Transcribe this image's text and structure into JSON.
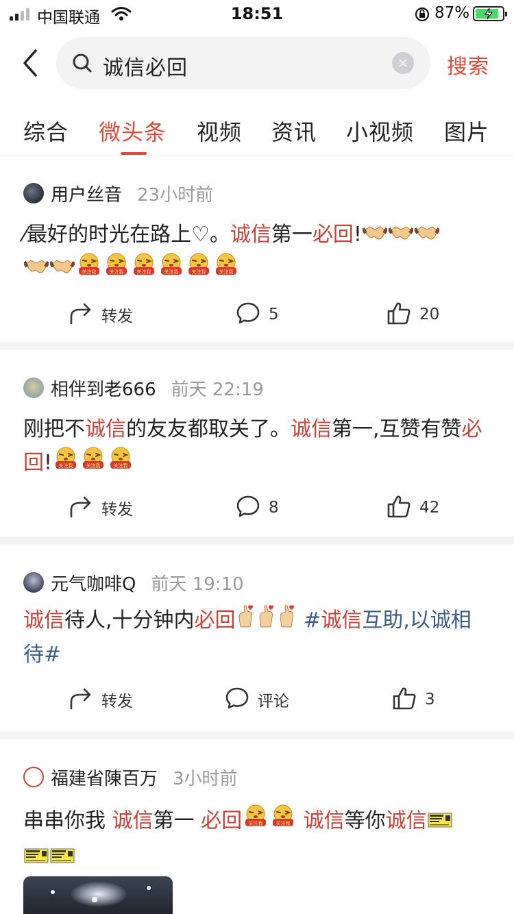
{
  "status_bar": {
    "carrier": "中国联通",
    "time": "18:51",
    "battery_pct": "87%",
    "battery_level": 0.87
  },
  "search": {
    "query": "诚信必回",
    "submit_label": "搜索"
  },
  "tabs": [
    {
      "label": "综合",
      "active": false
    },
    {
      "label": "微头条",
      "active": true
    },
    {
      "label": "视频",
      "active": false
    },
    {
      "label": "资讯",
      "active": false
    },
    {
      "label": "小视频",
      "active": false
    },
    {
      "label": "图片",
      "active": false
    }
  ],
  "posts": [
    {
      "author": "用户丝音",
      "time": "23小时前",
      "content": [
        {
          "t": "⁄最好的时光在路上♡。"
        },
        {
          "t": "诚信",
          "hl": true
        },
        {
          "t": "第一"
        },
        {
          "t": "必回",
          "hl": true
        },
        {
          "t": "!"
        }
      ],
      "emoji_line1": [
        "handshake-emoji",
        "handshake-emoji",
        "handshake-emoji"
      ],
      "emoji_line2": [
        "handshake-emoji",
        "handshake-emoji",
        "follow-me-emoji",
        "follow-me-emoji",
        "follow-me-emoji",
        "follow-me-emoji",
        "follow-me-emoji",
        "follow-me-emoji"
      ],
      "actions": {
        "repost": "转发",
        "comment": "5",
        "like": "20"
      }
    },
    {
      "author": "相伴到老666",
      "time": "前天 22:19",
      "content": [
        {
          "t": "刚把不"
        },
        {
          "t": "诚信",
          "hl": true
        },
        {
          "t": "的友友都取关了。"
        },
        {
          "t": "诚信",
          "hl": true
        },
        {
          "t": "第一,互赞有赞"
        },
        {
          "t": "必回",
          "hl": true
        },
        {
          "t": "!"
        }
      ],
      "emoji_tail": [
        "follow-me-emoji",
        "follow-me-emoji",
        "follow-me-emoji"
      ],
      "actions": {
        "repost": "转发",
        "comment": "8",
        "like": "42"
      }
    },
    {
      "author": "元气咖啡Q",
      "time": "前天 19:10",
      "content": [
        {
          "t": "诚信",
          "hl": true
        },
        {
          "t": "待人,十分钟内"
        },
        {
          "t": "必回",
          "hl": true
        }
      ],
      "hashtag_parts": [
        {
          "t": "#"
        },
        {
          "t": "诚信",
          "hl": true
        },
        {
          "t": "互助,以诚相待#"
        }
      ],
      "actions": {
        "repost": "转发",
        "comment": "评论",
        "like": "3"
      }
    },
    {
      "author": "福建省陳百万",
      "time": "3小时前",
      "content_a": "串串你我 ",
      "content_b": "诚信",
      "content_c": "第一 ",
      "content_d": "必回",
      "content_e": " ",
      "content_f": "诚信",
      "content_g": "等你",
      "content_h": "诚信"
    }
  ],
  "colors": {
    "accent": "#e04b3b",
    "highlight": "#c8423a",
    "hashtag": "#3b5c85"
  }
}
